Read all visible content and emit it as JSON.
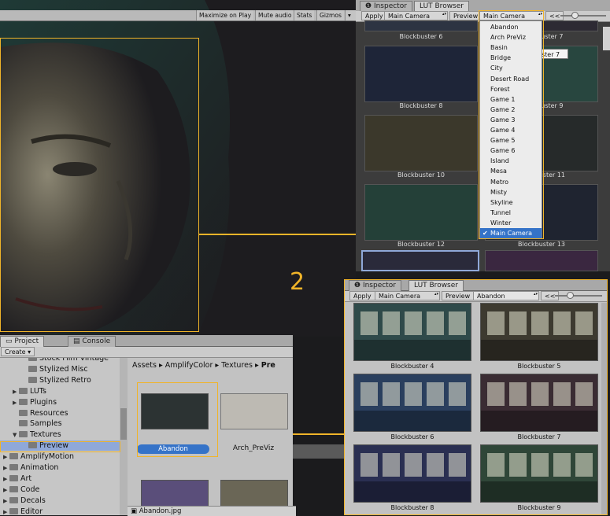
{
  "game_toolbar": {
    "buttons": [
      "Maximize on Play",
      "Mute audio",
      "Stats",
      "Gizmos"
    ]
  },
  "step_number": "2",
  "top_panel": {
    "tabs": [
      "Inspector",
      "LUT Browser"
    ],
    "toolbar": {
      "apply": "Apply",
      "camera": "Main Camera",
      "preview": "Preview",
      "lut": "Main Camera",
      "back": "<<"
    },
    "thumbnails": [
      {
        "label": "Blockbuster 6"
      },
      {
        "label": "Blockbuster 7"
      },
      {
        "label": "Blockbuster 8"
      },
      {
        "label": "Blockbuster 9"
      },
      {
        "label": "Blockbuster 10"
      },
      {
        "label": "Blockbuster 11"
      },
      {
        "label": "Blockbuster 12"
      },
      {
        "label": "Blockbuster 13"
      }
    ],
    "tooltip": "ster 7",
    "menu": {
      "items": [
        "Abandon",
        "Arch PreViz",
        "Basin",
        "Bridge",
        "City",
        "Desert Road",
        "Forest",
        "Game 1",
        "Game 2",
        "Game 3",
        "Game 4",
        "Game 5",
        "Game 6",
        "Island",
        "Mesa",
        "Metro",
        "Misty",
        "Skyline",
        "Tunnel",
        "Winter",
        "Main Camera"
      ],
      "selected": "Main Camera",
      "check": "✔"
    }
  },
  "bottom_panel": {
    "tabs": [
      "Inspector",
      "LUT Browser"
    ],
    "toolbar": {
      "apply": "Apply",
      "camera": "Main Camera",
      "preview": "Preview",
      "lut": "Abandon",
      "back": "<<"
    },
    "thumbnails": [
      {
        "label": "Blockbuster 4",
        "tint": "#2f4a4a"
      },
      {
        "label": "Blockbuster 5",
        "tint": "#3d3a30"
      },
      {
        "label": "Blockbuster 6",
        "tint": "#2a3f5e"
      },
      {
        "label": "Blockbuster 7",
        "tint": "#3a2c33"
      },
      {
        "label": "Blockbuster 8",
        "tint": "#2a2f52"
      },
      {
        "label": "Blockbuster 9",
        "tint": "#2f4638"
      }
    ]
  },
  "project": {
    "tabs": [
      "Project",
      "Console"
    ],
    "create": "Create",
    "tree": [
      {
        "label": "Stock Film Vintage",
        "indent": 3,
        "arrow": ""
      },
      {
        "label": "Stylized Misc",
        "indent": 3,
        "arrow": ""
      },
      {
        "label": "Stylized Retro",
        "indent": 3,
        "arrow": ""
      },
      {
        "label": "LUTs",
        "indent": 2,
        "arrow": "▶"
      },
      {
        "label": "Plugins",
        "indent": 2,
        "arrow": "▶"
      },
      {
        "label": "Resources",
        "indent": 2,
        "arrow": ""
      },
      {
        "label": "Samples",
        "indent": 2,
        "arrow": ""
      },
      {
        "label": "Textures",
        "indent": 2,
        "arrow": "▼"
      },
      {
        "label": "Preview",
        "indent": 3,
        "arrow": ""
      },
      {
        "label": "AmplifyMotion",
        "indent": 1,
        "arrow": "▶"
      },
      {
        "label": "Animation",
        "indent": 1,
        "arrow": "▶"
      },
      {
        "label": "Art",
        "indent": 1,
        "arrow": "▶"
      },
      {
        "label": "Code",
        "indent": 1,
        "arrow": "▶"
      },
      {
        "label": "Decals",
        "indent": 1,
        "arrow": "▶"
      },
      {
        "label": "Editor",
        "indent": 1,
        "arrow": "▶"
      }
    ],
    "selected_tree": "Preview",
    "breadcrumb": [
      "Assets",
      "AmplifyColor",
      "Textures",
      "Pre"
    ],
    "assets": [
      {
        "label": "Abandon",
        "selected": true
      },
      {
        "label": "Arch_PreViz",
        "selected": false
      }
    ],
    "status_file": "Abandon.jpg"
  },
  "colors": {
    "highlight": "#f0b429",
    "selection": "#3573c8"
  }
}
